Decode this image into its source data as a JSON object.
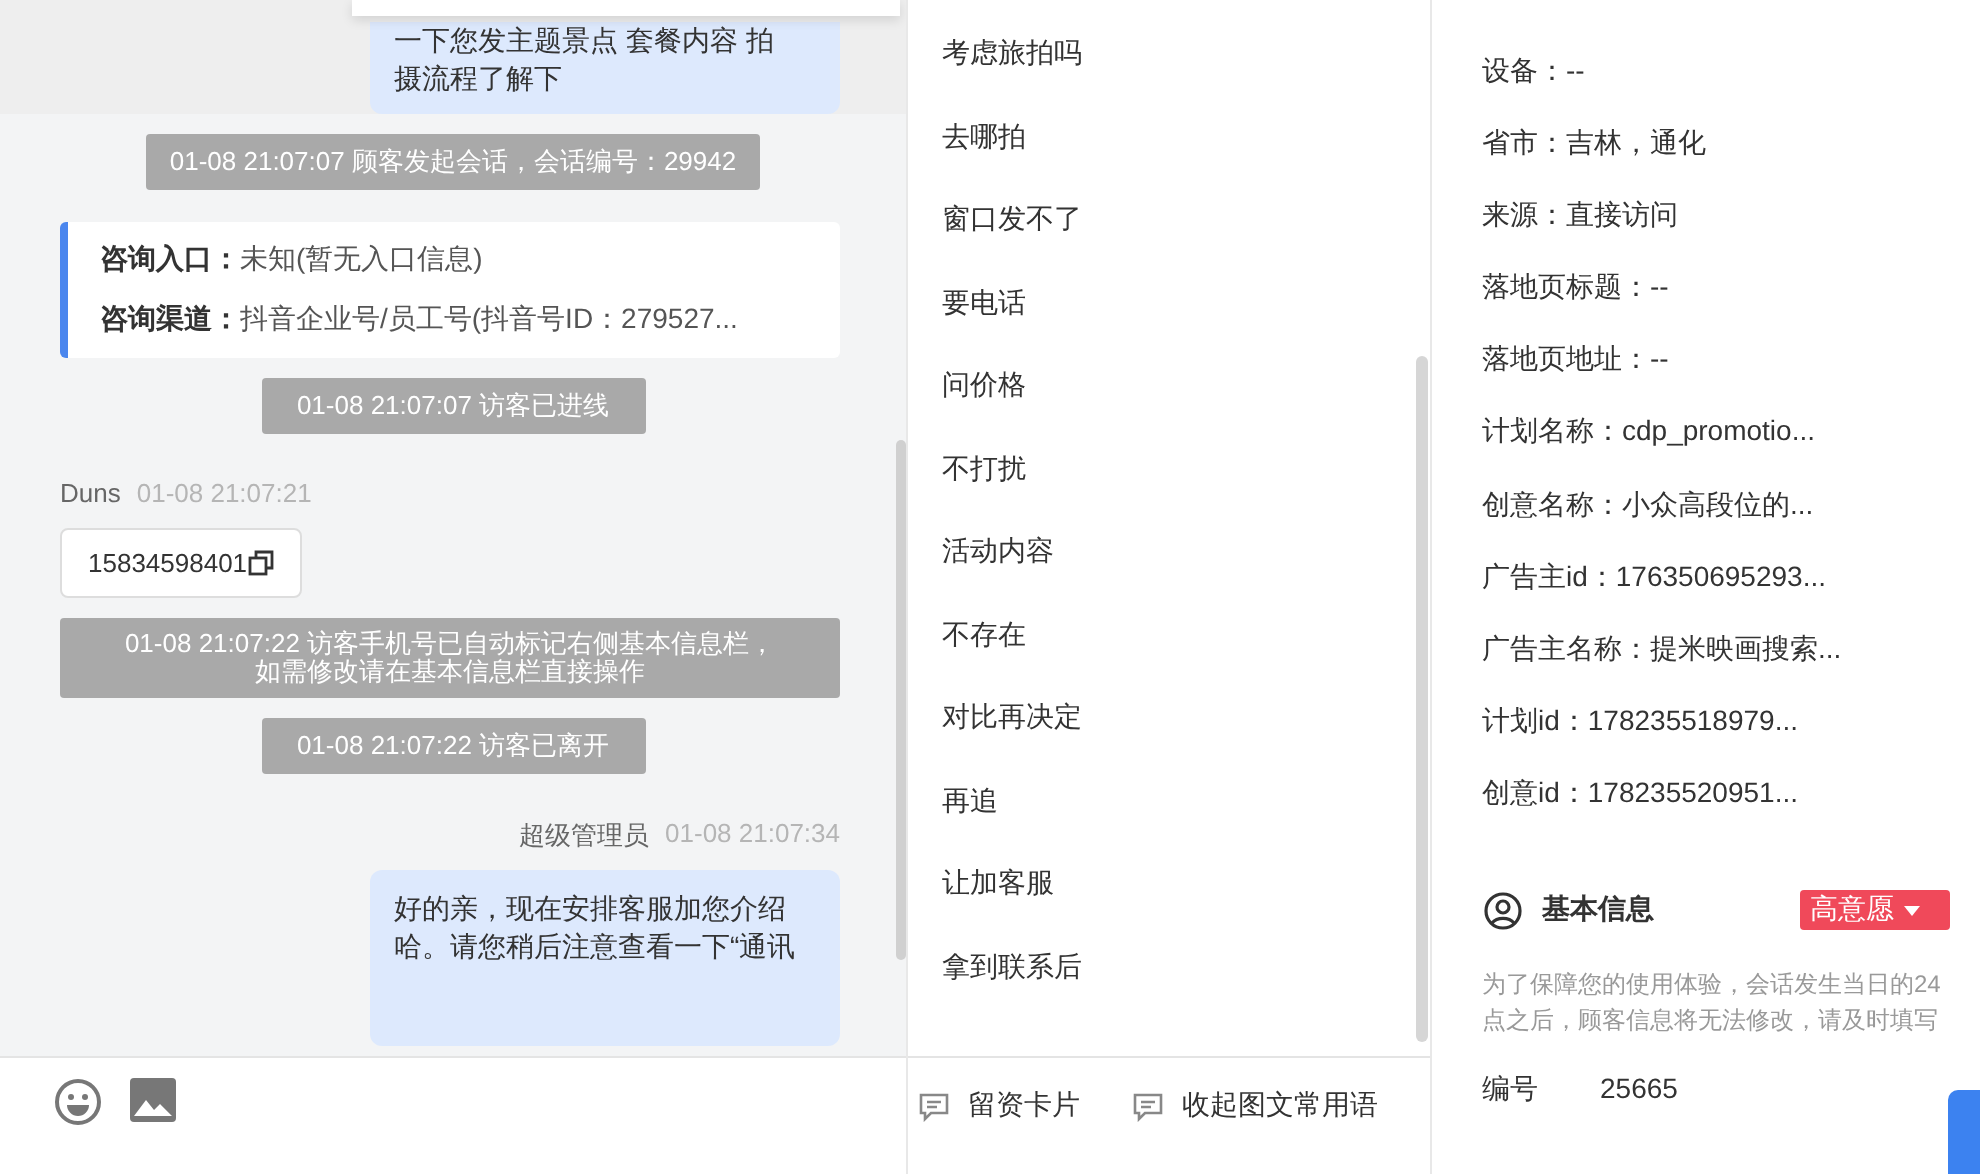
{
  "chat": {
    "messages": [
      {
        "kind": "bubble",
        "text": "一下您发主题景点 套餐内容 拍摄流程了解下"
      },
      {
        "kind": "system",
        "text": "01-08 21:07:07 顾客发起会话，会话编号：29942"
      },
      {
        "kind": "info",
        "rows": [
          {
            "label": "咨询入口：",
            "value": "未知(暂无入口信息)"
          },
          {
            "label": "咨询渠道：",
            "value": "抖音企业号/员工号(抖音号ID：279527..."
          }
        ]
      },
      {
        "kind": "system",
        "text": "01-08 21:07:07 访客已进线"
      },
      {
        "kind": "visitor",
        "sender": "Duns",
        "time": "01-08 21:07:21",
        "text": "15834598401"
      },
      {
        "kind": "system",
        "text": "01-08 21:07:22 访客手机号已自动标记右侧基本信息栏，如需修改请在基本信息栏直接操作"
      },
      {
        "kind": "system",
        "text": "01-08 21:07:22 访客已离开"
      },
      {
        "kind": "agent",
        "sender": "超级管理员",
        "time": "01-08 21:07:34",
        "text": "好的亲，现在安排客服加您介绍哈。请您稍后注意查看一下“通讯"
      }
    ]
  },
  "phrases": [
    "考虑旅拍吗",
    "去哪拍",
    "窗口发不了",
    "要电话",
    "问价格",
    "不打扰",
    "活动内容",
    "不存在",
    "对比再决定",
    "再追",
    "让加客服",
    "拿到联系后"
  ],
  "phrase_actions": [
    "留资卡片",
    "收起图文常用语"
  ],
  "visitor_info": [
    "设备：--",
    "省市：吉林，通化",
    "来源：直接访问",
    "落地页标题：--",
    "落地页地址：--",
    "计划名称：cdp_promotio...",
    "创意名称：小众高段位的...",
    "广告主id：176350695293...",
    "广告主名称：提米映画搜索...",
    "计划id：178235518979...",
    "创意id：178235520951..."
  ],
  "basic_info": {
    "title": "基本信息",
    "intent": "高意愿",
    "note": "为了保障您的使用体验，会话发生当日的24点之后，顾客信息将无法修改，请及时填写",
    "fields": [
      {
        "label": "编号",
        "value": "25665"
      }
    ]
  }
}
